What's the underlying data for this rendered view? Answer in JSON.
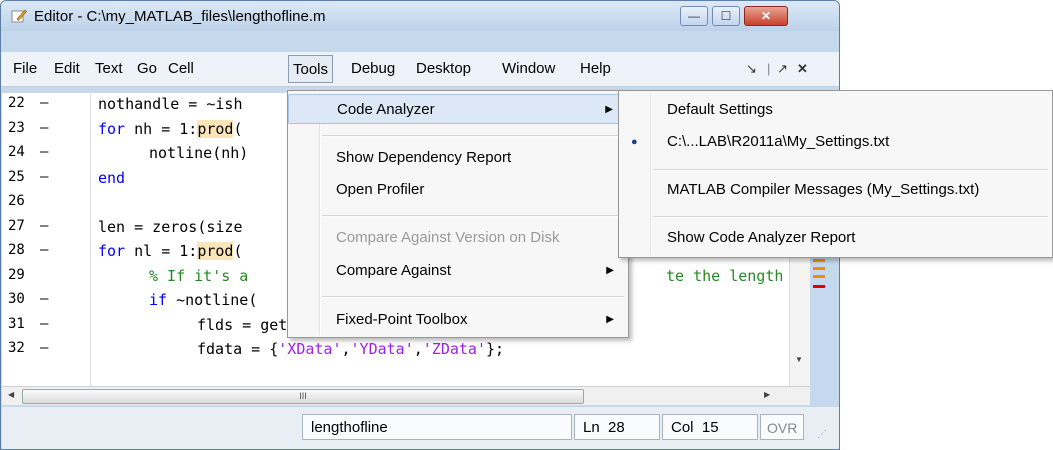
{
  "window": {
    "title": "Editor - C:\\my_MATLAB_files\\lengthofline.m",
    "controls": {
      "minimize": "—",
      "maximize": "☐",
      "close": "✕"
    }
  },
  "menubar": {
    "items": [
      "File",
      "Edit",
      "Text",
      "Go",
      "Cell",
      "Tools",
      "Debug",
      "Desktop",
      "Window",
      "Help"
    ],
    "active": "Tools",
    "right_icons": {
      "dock": "↘",
      "undock": "↗",
      "close": "✕"
    }
  },
  "editor": {
    "lines": [
      {
        "num": "22",
        "dash": "–",
        "code": "nothandle = ~ish"
      },
      {
        "num": "23",
        "dash": "–",
        "code": "for nh = 1:prod("
      },
      {
        "num": "24",
        "dash": "–",
        "code": "notline(nh)"
      },
      {
        "num": "25",
        "dash": "–",
        "code": "end"
      },
      {
        "num": "26",
        "dash": "",
        "code": ""
      },
      {
        "num": "27",
        "dash": "–",
        "code": "len = zeros(size"
      },
      {
        "num": "28",
        "dash": "–",
        "code": "for nl = 1:prod("
      },
      {
        "num": "29",
        "dash": "",
        "code": "% If it's a",
        "code2": "te the length"
      },
      {
        "num": "30",
        "dash": "–",
        "code": "if ~notline("
      },
      {
        "num": "31",
        "dash": "–",
        "code": "flds = get(hline(nl));"
      },
      {
        "num": "32",
        "dash": "–",
        "code": "fdata = {'XData','YData','ZData'};"
      }
    ],
    "hscroll_grip": "III"
  },
  "tools_menu": {
    "items": [
      {
        "label": "Code Analyzer",
        "submenu": true,
        "state": "hover"
      },
      {
        "label": "Show Dependency Report"
      },
      {
        "label": "Open Profiler"
      },
      {
        "label": "Compare Against Version on Disk",
        "state": "disabled"
      },
      {
        "label": "Compare Against",
        "submenu": true
      },
      {
        "label": "Fixed-Point Toolbox",
        "submenu": true
      }
    ],
    "arrow": "▶"
  },
  "code_analyzer_menu": {
    "items": [
      {
        "label": "Default Settings"
      },
      {
        "label": "C:\\...LAB\\R2011a\\My_Settings.txt",
        "selected": true
      },
      {
        "label": "MATLAB Compiler Messages (My_Settings.txt)"
      },
      {
        "label": "Show Code Analyzer Report"
      }
    ],
    "bullet": "●"
  },
  "statusbar": {
    "function": "lengthofline",
    "ln_label": "Ln",
    "ln_value": "28",
    "col_label": "Col",
    "col_value": "15",
    "mode": "OVR"
  },
  "colors": {
    "keyword": "#0000ff",
    "comment": "#228b22",
    "string": "#a020f0",
    "highlight": "#f9e5b8",
    "marker_orange": "#f08c00",
    "marker_red": "#e00000"
  }
}
